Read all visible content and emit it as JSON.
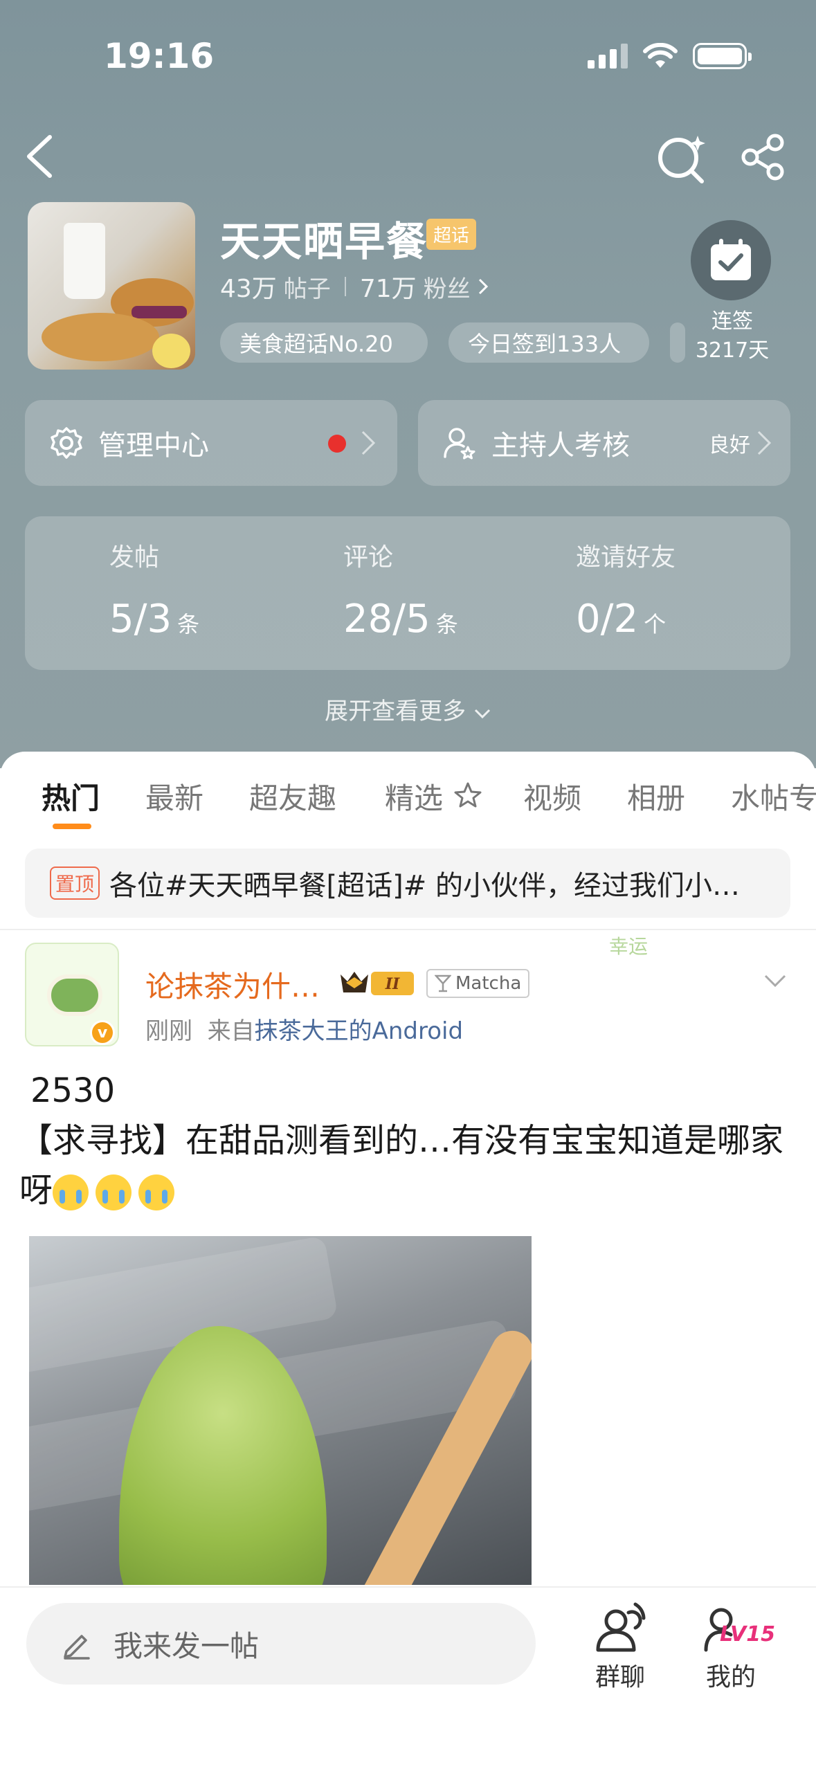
{
  "status_bar": {
    "time": "19:16"
  },
  "icons": {
    "back": "chevron-left-icon",
    "search": "search-icon",
    "share": "share-icon",
    "checkin": "calendar-check-icon",
    "settings": "gear-icon",
    "host": "user-star-icon",
    "pen": "pen-icon",
    "group_chat": "group-chat-icon",
    "me": "user-icon"
  },
  "header": {
    "title": "天天晒早餐",
    "super_tag": "超话",
    "posts_count": "43万",
    "posts_label": "帖子",
    "fans_count": "71万",
    "fans_label": "粉丝",
    "pills": [
      "美食超话No.20",
      "今日签到133人"
    ],
    "checkin_label": "连签",
    "checkin_days": "3217天"
  },
  "panels": {
    "manage_label": "管理中心",
    "host_label": "主持人考核",
    "host_status": "良好"
  },
  "stats": [
    {
      "label": "发帖",
      "value": "5/3",
      "unit": "条"
    },
    {
      "label": "评论",
      "value": "28/5",
      "unit": "条"
    },
    {
      "label": "邀请好友",
      "value": "0/2",
      "unit": "个"
    }
  ],
  "expand_label": "展开查看更多",
  "tabs": [
    "热门",
    "最新",
    "超友趣",
    "精选",
    "视频",
    "相册",
    "水帖专"
  ],
  "pinned": {
    "tag": "置顶",
    "text": "各位#天天晒早餐[超话]# 的小伙伴，经过我们小…"
  },
  "post": {
    "username": "论抹茶为什…",
    "vip_level": "II",
    "fan_badge": "Matcha",
    "avatar_badge": "v",
    "time": "刚刚",
    "source_prefix": "来自",
    "source": "抹茶大王的Android",
    "text_line1": "2530",
    "text_line2": "【求寻找】在甜品测看到的…有没有宝宝知道是哪家呀",
    "deco_text": "幸运"
  },
  "bottom_bar": {
    "input_placeholder": "我来发一帖",
    "group_chat": "群聊",
    "me": "我的",
    "level": "LV15"
  }
}
